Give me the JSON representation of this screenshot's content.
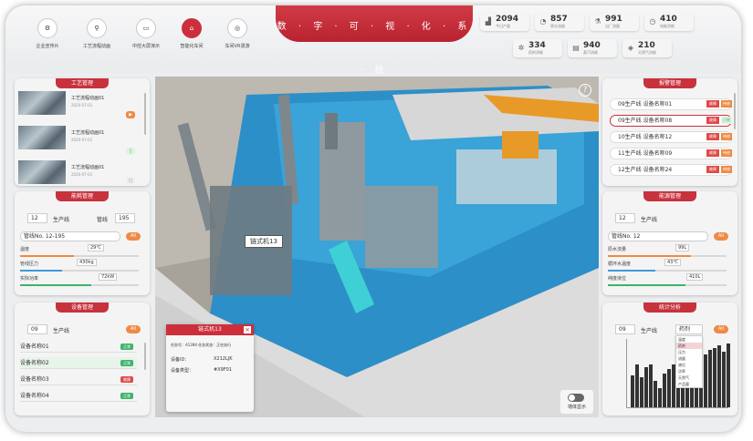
{
  "header": {
    "title": "数 · 字 · 可 · 视 · 化 · 系 · 统"
  },
  "nav": [
    {
      "label": "企业宣传片",
      "icon": "gear-icon"
    },
    {
      "label": "工艺流程动画",
      "icon": "flow-icon"
    },
    {
      "label": "中控大屏演示",
      "icon": "screen-icon"
    },
    {
      "label": "智能化车间",
      "icon": "home-icon"
    },
    {
      "label": "车间VR漫游",
      "icon": "vr-icon"
    }
  ],
  "stats": [
    {
      "value": "2094",
      "label": "今日产量",
      "icon": "chart-icon"
    },
    {
      "value": "857",
      "label": "原水流量",
      "icon": "speed-icon"
    },
    {
      "value": "991",
      "label": "出厂流量",
      "icon": "flask-icon"
    },
    {
      "value": "410",
      "label": "电能消耗",
      "icon": "clock-icon"
    },
    {
      "value": "334",
      "label": "药剂消耗",
      "icon": "gear-icon"
    },
    {
      "value": "940",
      "label": "蒸汽消耗",
      "icon": "book-icon"
    },
    {
      "value": "210",
      "label": "天然气消耗",
      "icon": "tag-icon"
    }
  ],
  "process": {
    "title": "工艺管理",
    "items": [
      {
        "name": "工艺流程动画01",
        "date": "2020-07-01",
        "badge": "▶"
      },
      {
        "name": "工艺流程动画01",
        "date": "2020-07-01",
        "badge": "▯"
      },
      {
        "name": "工艺流程动画01",
        "date": "2020-07-01",
        "badge": "◻"
      }
    ]
  },
  "energy": {
    "title": "能耗管理",
    "line_number": "12",
    "line_label": "生产线",
    "pipe_label": "管线",
    "pipe_number": "195",
    "all_label": "All",
    "select_value": "管线No. 12-195",
    "metrics": [
      {
        "label": "温度",
        "value": "29℃",
        "percent": 45,
        "color": "#f08a3c"
      },
      {
        "label": "管线压力",
        "value": "430kg",
        "percent": 35,
        "color": "#3f9ad8"
      },
      {
        "label": "实际功率",
        "value": "72kW",
        "percent": 60,
        "color": "#3fb36a"
      }
    ]
  },
  "device": {
    "title": "设备管理",
    "line_number": "09",
    "line_label": "生产线",
    "all_label": "All",
    "rows": [
      {
        "name": "设备名称01",
        "status": "正常",
        "color": "#3fb36a"
      },
      {
        "name": "设备名称02",
        "status": "正常",
        "color": "#3fb36a"
      },
      {
        "name": "设备名称03",
        "status": "故障",
        "color": "#e04a4a"
      },
      {
        "name": "设备名称04",
        "status": "正常",
        "color": "#3fb36a"
      }
    ]
  },
  "alarm": {
    "title": "报警管理",
    "rows": [
      {
        "line": "09生产线",
        "device": "设备名称01",
        "status": "故障",
        "action": "待修"
      },
      {
        "line": "09生产线",
        "device": "设备名称08",
        "status": "故障",
        "action": "已修"
      },
      {
        "line": "10生产线",
        "device": "设备名称12",
        "status": "故障",
        "action": "待修"
      },
      {
        "line": "11生产线",
        "device": "设备名称09",
        "status": "故障",
        "action": "待修"
      },
      {
        "line": "12生产线",
        "device": "设备名称24",
        "status": "故障",
        "action": "待修"
      }
    ]
  },
  "material": {
    "title": "能源管理",
    "line_number": "12",
    "line_label": "生产线",
    "all_label": "All",
    "select_value": "管线No. 12",
    "metrics": [
      {
        "label": "原水流量",
        "value": "99L",
        "percent": 70,
        "color": "#f08a3c"
      },
      {
        "label": "循环水温度",
        "value": "43℃",
        "percent": 40,
        "color": "#3f9ad8"
      },
      {
        "label": "纯度液位",
        "value": "410L",
        "percent": 65,
        "color": "#3fb36a"
      }
    ]
  },
  "stats_panel": {
    "title": "统计分析",
    "line_number": "09",
    "line_label": "生产线",
    "dropdown_value": "药剂",
    "all_label": "All",
    "options": [
      "温度",
      "药剂",
      "压力",
      "流量",
      "液位",
      "功率",
      "天然气",
      "产品量"
    ],
    "bars": [
      30,
      40,
      28,
      38,
      40,
      25,
      18,
      32,
      36,
      40,
      42,
      44,
      38,
      48,
      52,
      46,
      50,
      54,
      56,
      58,
      52,
      60
    ]
  },
  "scene": {
    "machine_label": "链式机13",
    "help": "?",
    "toggle_label": "墙体显示",
    "popup": {
      "title": "链式机13",
      "line1": "任务号：A1394  任务状态：正在执行",
      "id_label": "设备ID：",
      "id_value": "X212LJK",
      "type_label": "设备类型：",
      "type_value": "#X9F01"
    }
  }
}
